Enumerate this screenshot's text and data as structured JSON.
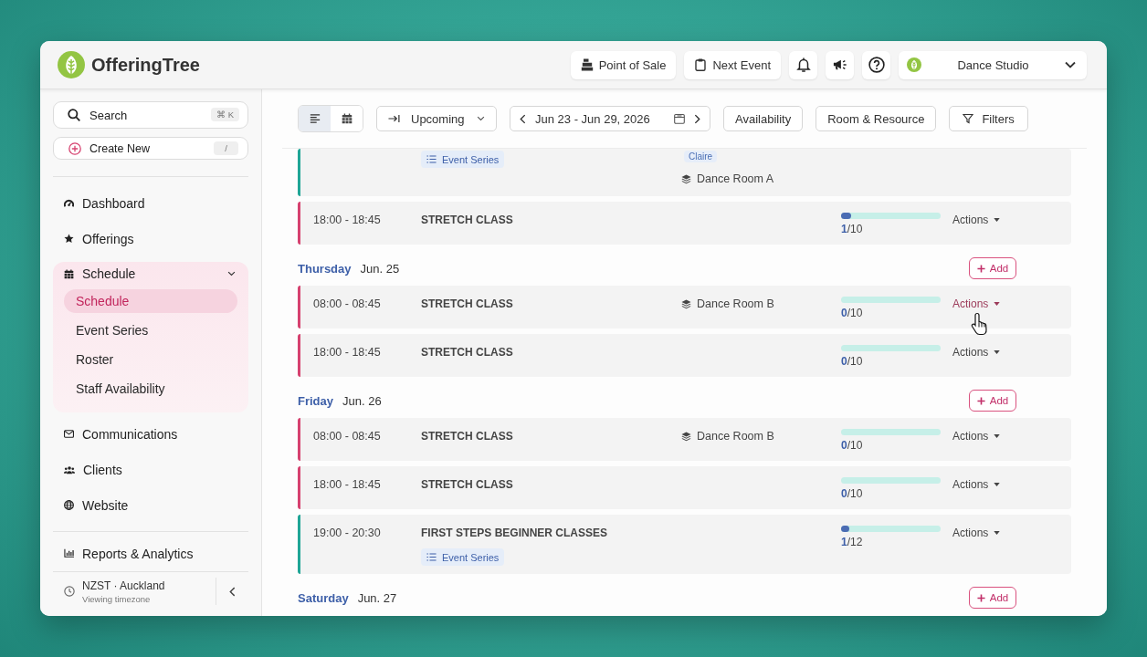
{
  "header": {
    "logo": "OfferingTree",
    "buttons": [
      {
        "kind": "register",
        "label": "Point of Sale"
      },
      {
        "kind": "clipboard",
        "label": "Next Event"
      },
      {
        "kind": "bell"
      },
      {
        "kind": "megaphone"
      },
      {
        "kind": "help"
      }
    ],
    "studio": {
      "name": "Dance Studio"
    }
  },
  "sidebar": {
    "search": {
      "placeholder": "Search",
      "shortcut": "⌘ K"
    },
    "create": {
      "label": "Create New",
      "shortcut": "/"
    },
    "nav": [
      {
        "kind": "gauge",
        "label": "Dashboard"
      },
      {
        "kind": "star",
        "label": "Offerings"
      },
      {
        "kind": "calendar",
        "label": "Schedule",
        "expanded": true,
        "children": [
          {
            "label": "Schedule",
            "selected": true
          },
          {
            "label": "Event Series",
            "selected": false
          },
          {
            "label": "Roster",
            "selected": false
          },
          {
            "label": "Staff Availability",
            "selected": false
          }
        ]
      },
      {
        "kind": "envelope",
        "label": "Communications"
      },
      {
        "kind": "users",
        "label": "Clients"
      },
      {
        "kind": "globe",
        "label": "Website"
      }
    ],
    "secondary_nav": [
      {
        "kind": "chart",
        "label": "Reports & Analytics"
      }
    ],
    "timezone": {
      "name": "NZST · Auckland",
      "caption": "Viewing timezone"
    }
  },
  "toolbar": {
    "views": [
      {
        "kind": "list",
        "selected": true
      },
      {
        "kind": "calendar",
        "selected": false
      }
    ],
    "mode": {
      "label": "Upcoming"
    },
    "date_range": {
      "label": "Jun 23 - Jun 29, 2026"
    },
    "buttons": [
      {
        "kind": "plain",
        "label": "Availability"
      },
      {
        "kind": "plain",
        "label": "Room & Resource"
      },
      {
        "kind": "filter",
        "label": "Filters"
      }
    ]
  },
  "schedule": {
    "days": [
      {
        "events": [
          {
            "color": "#1fa596",
            "tag": "Event Series",
            "instructor": "Claire",
            "room": "Dance Room A"
          },
          {
            "time": "18:00 - 18:45",
            "title": "STRETCH CLASS",
            "color": "#d6416f",
            "attendance": "**1**/10",
            "level": 0.1,
            "actions": {
              "label": "Actions",
              "hovered": false
            }
          }
        ]
      },
      {
        "day": "Thursday",
        "date": "Jun. 25",
        "add": "Add",
        "events": [
          {
            "time": "08:00 - 08:45",
            "title": "STRETCH CLASS",
            "room": "Dance Room B",
            "color": "#d6416f",
            "attendance": "**0**/10",
            "level": 0,
            "actions": {
              "label": "Actions",
              "hovered": true
            }
          },
          {
            "time": "18:00 - 18:45",
            "title": "STRETCH CLASS",
            "color": "#d6416f",
            "attendance": "**0**/10",
            "level": 0,
            "actions": {
              "label": "Actions",
              "hovered": false
            }
          }
        ]
      },
      {
        "day": "Friday",
        "date": "Jun. 26",
        "add": "Add",
        "events": [
          {
            "time": "08:00 - 08:45",
            "title": "STRETCH CLASS",
            "room": "Dance Room B",
            "color": "#d6416f",
            "attendance": "**0**/10",
            "level": 0,
            "actions": {
              "label": "Actions",
              "hovered": false
            }
          },
          {
            "time": "18:00 - 18:45",
            "title": "STRETCH CLASS",
            "color": "#d6416f",
            "attendance": "**0**/10",
            "level": 0,
            "actions": {
              "label": "Actions",
              "hovered": false
            }
          },
          {
            "time": "19:00 - 20:30",
            "title": "FIRST STEPS BEGINNER CLASSES",
            "tag": "Event Series",
            "color": "#1fa596",
            "attendance": "**1**/12",
            "level": 0.083,
            "actions": {
              "label": "Actions",
              "hovered": false
            }
          }
        ]
      },
      {
        "day": "Saturday",
        "date": "Jun. 27",
        "add": "Add"
      }
    ]
  }
}
